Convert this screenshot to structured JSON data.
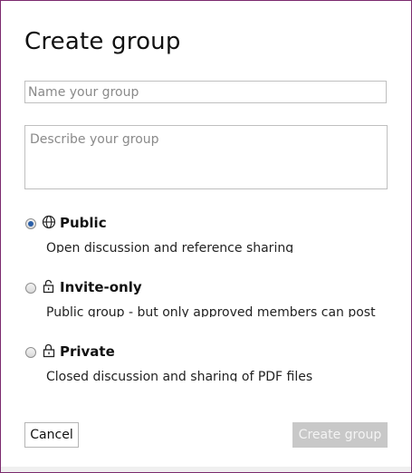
{
  "dialog": {
    "title": "Create group",
    "name_placeholder": "Name your group",
    "name_value": "",
    "description_placeholder": "Describe your group",
    "description_value": ""
  },
  "options": [
    {
      "label": "Public",
      "description": "Open discussion and reference sharing",
      "icon": "globe-icon",
      "selected": true
    },
    {
      "label": "Invite-only",
      "description": "Public group - but only approved members can post",
      "icon": "unlocked-padlock-icon",
      "selected": false
    },
    {
      "label": "Private",
      "description": "Closed discussion and sharing of PDF files",
      "icon": "locked-padlock-icon",
      "selected": false
    }
  ],
  "buttons": {
    "cancel_label": "Cancel",
    "create_label": "Create group",
    "create_enabled": false
  },
  "colors": {
    "frame_border": "#7b2a6e",
    "input_border": "#bfbfbf",
    "radio_selected": "#2a5fa8",
    "disabled_button_bg": "#c8c8c8",
    "disabled_button_text": "#f4f4f4"
  }
}
